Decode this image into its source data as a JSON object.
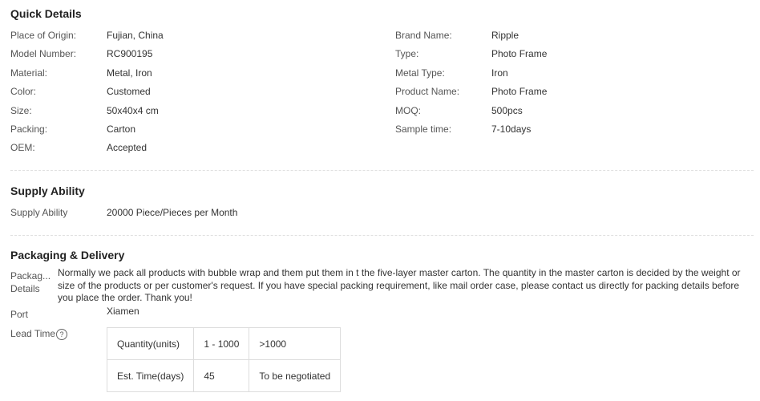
{
  "quick_details": {
    "title": "Quick Details",
    "left": [
      {
        "label": "Place of Origin:",
        "value": "Fujian, China"
      },
      {
        "label": "Model Number:",
        "value": "RC900195"
      },
      {
        "label": "Material:",
        "value": "Metal, Iron"
      },
      {
        "label": "Color:",
        "value": "Customed"
      },
      {
        "label": "Size:",
        "value": "50x40x4 cm"
      },
      {
        "label": "Packing:",
        "value": "Carton"
      },
      {
        "label": "OEM:",
        "value": "Accepted"
      }
    ],
    "right": [
      {
        "label": "Brand Name:",
        "value": "Ripple"
      },
      {
        "label": "Type:",
        "value": "Photo Frame"
      },
      {
        "label": "Metal Type:",
        "value": "Iron"
      },
      {
        "label": "Product Name:",
        "value": "Photo Frame"
      },
      {
        "label": "MOQ:",
        "value": "500pcs"
      },
      {
        "label": "Sample time:",
        "value": "7-10days"
      }
    ]
  },
  "supply_ability": {
    "title": "Supply Ability",
    "label": "Supply Ability",
    "value": "20000 Piece/Pieces per Month"
  },
  "packaging_delivery": {
    "title": "Packaging & Delivery",
    "packaging_label_line1": "Packag...",
    "packaging_label_line2": "Details",
    "packaging_details": "Normally we pack all products with bubble wrap and them put them in t the five-layer master carton. The quantity in the master carton is decided by the weight or size of the products or per customer's request. If you have special packing requirement, like mail order case, please contact us directly for packing details before you place the order. Thank you!",
    "port_label": "Port",
    "port_value": "Xiamen",
    "lead_time_label": "Lead Time",
    "help_glyph": "?",
    "lead_time_table": {
      "rows": [
        [
          "Quantity(units)",
          "1 - 1000",
          ">1000"
        ],
        [
          "Est. Time(days)",
          "45",
          "To be negotiated"
        ]
      ]
    }
  }
}
